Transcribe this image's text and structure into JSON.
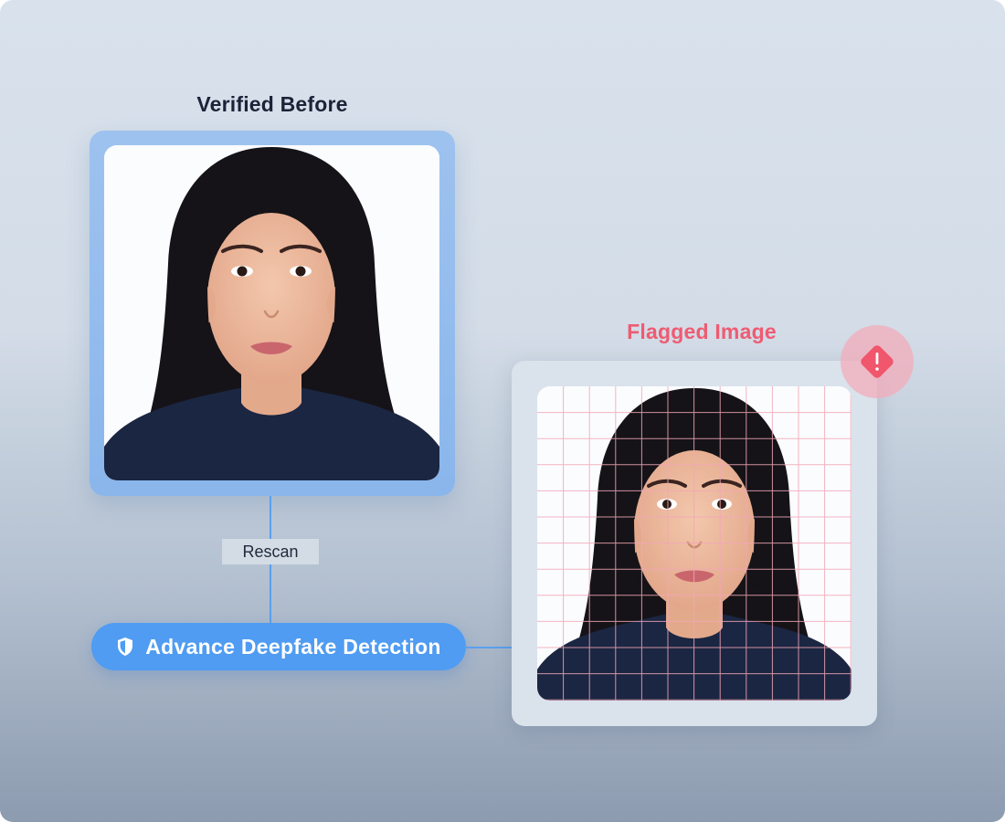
{
  "verified": {
    "title": "Verified Before"
  },
  "flagged": {
    "title": "Flagged Image",
    "warning_icon": "warning-diamond-icon"
  },
  "connector": {
    "rescan_label": "Rescan"
  },
  "detection": {
    "label": "Advance Deepfake Detection",
    "icon": "shield-icon"
  },
  "colors": {
    "accent_blue": "#4f9cf2",
    "card_blue": "#8ab6ec",
    "alert_red": "#ef5b72",
    "grid_pink": "#f2a7b8",
    "text_dark": "#1b2338"
  }
}
